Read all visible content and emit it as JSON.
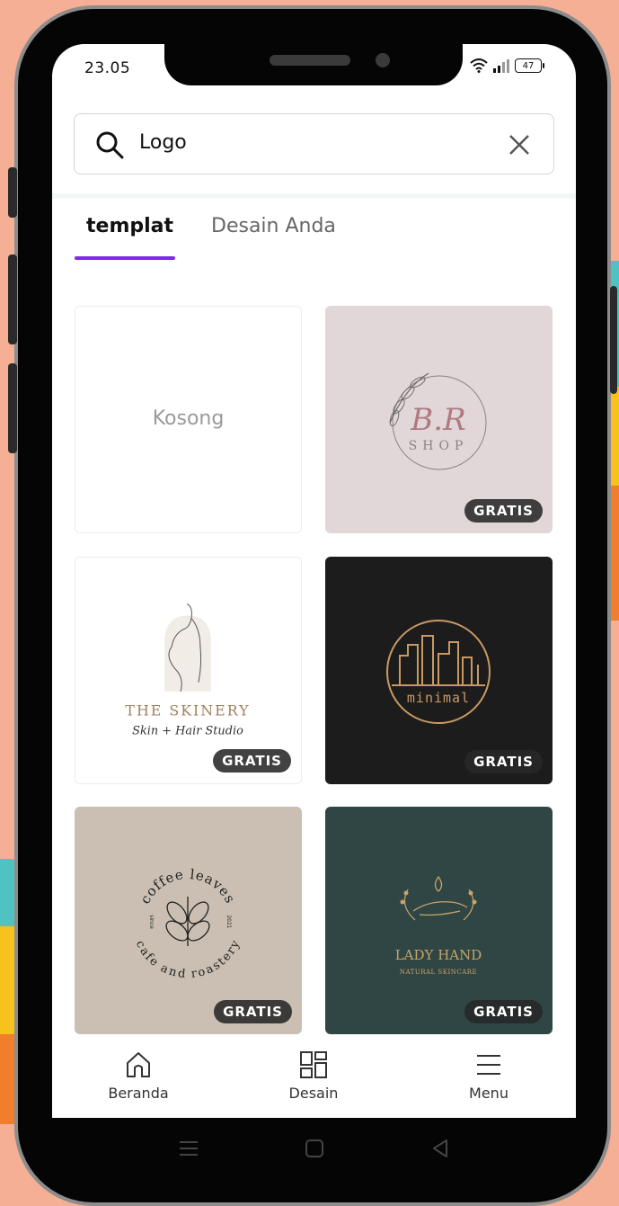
{
  "status_bar": {
    "time": "23.05",
    "battery": "47"
  },
  "search": {
    "query": "Logo"
  },
  "tabs": [
    {
      "label": "templat"
    },
    {
      "label": "Desain Anda"
    }
  ],
  "cards": [
    {
      "empty_label": "Kosong"
    },
    {
      "art_text": [
        "B.R",
        "SHOP"
      ],
      "badge": "GRATIS"
    },
    {
      "art_text": [
        "THE SKINERY",
        "Skin + Hair Studio"
      ],
      "badge": "GRATIS"
    },
    {
      "art_text": [
        "minimal"
      ],
      "badge": "GRATIS"
    },
    {
      "art_text": [
        "coffee leaves",
        "cafe and roastery",
        "since",
        "2021"
      ],
      "badge": "GRATIS"
    },
    {
      "art_text": [
        "LADY HAND",
        "NATURAL SKINCARE"
      ],
      "badge": "GRATIS"
    }
  ],
  "bottom_nav": [
    {
      "label": "Beranda",
      "icon": "home-icon"
    },
    {
      "label": "Desain",
      "icon": "grid-icon"
    },
    {
      "label": "Menu",
      "icon": "menu-icon"
    }
  ],
  "colors": {
    "accent": "#7D2AE8",
    "background": "#F4AF95"
  }
}
